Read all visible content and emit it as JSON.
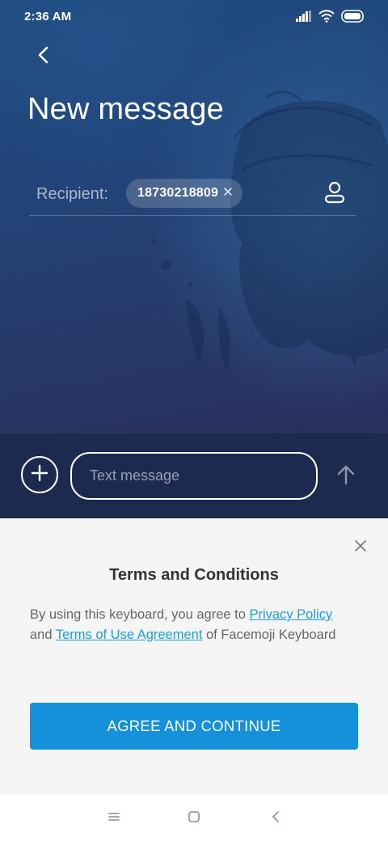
{
  "status_bar": {
    "time": "2:36 AM",
    "icons": [
      "signal-icon",
      "wifi-icon",
      "battery-icon"
    ]
  },
  "header": {
    "back_icon": "chevron-left-icon",
    "title": "New message"
  },
  "recipient": {
    "label": "Recipient:",
    "chip_value": "18730218809",
    "chip_remove_icon": "close-icon",
    "contact_icon": "person-icon"
  },
  "compose": {
    "add_icon": "plus-icon",
    "placeholder": "Text message",
    "value": "",
    "send_icon": "arrow-up-icon"
  },
  "terms": {
    "close_icon": "close-icon",
    "title": "Terms and Conditions",
    "body_prefix": "By using this keyboard, you agree to ",
    "privacy_link": "Privacy Policy",
    "body_middle": " and ",
    "terms_link": "Terms of Use Agreement",
    "body_suffix": " of Facemoji Keyboard",
    "agree_label": "AGREE AND CONTINUE"
  },
  "nav_bar": {
    "items": [
      "menu-icon",
      "home-icon",
      "back-icon"
    ]
  },
  "colors": {
    "accent": "#1591db",
    "link": "#1a9ee2",
    "compose_bg": "#1c2a4f",
    "sheet_bg": "#f5f5f5"
  }
}
